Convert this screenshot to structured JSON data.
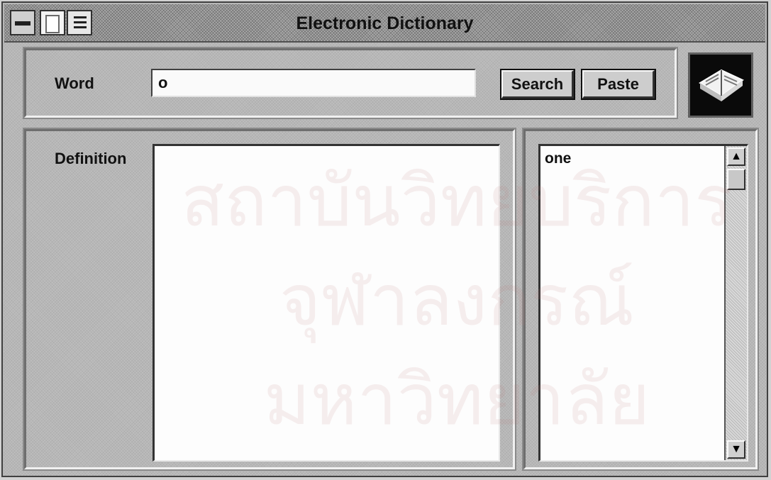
{
  "window": {
    "title": "Electronic Dictionary"
  },
  "search": {
    "label": "Word",
    "value": "o",
    "search_button": "Search",
    "paste_button": "Paste"
  },
  "definition": {
    "label": "Definition",
    "text": ""
  },
  "word_list": {
    "items": [
      "one"
    ]
  },
  "icons": {
    "title_controls": [
      "minimize-icon",
      "document-icon",
      "menu-icon"
    ],
    "app_logo": "book-icon",
    "scroll_up": "arrow-up-icon",
    "scroll_down": "arrow-down-icon"
  },
  "watermark": {
    "line1": "สถาบันวิทยบริการ",
    "line2": "จุฬาลงกรณ์มหาวิทยาลัย"
  }
}
